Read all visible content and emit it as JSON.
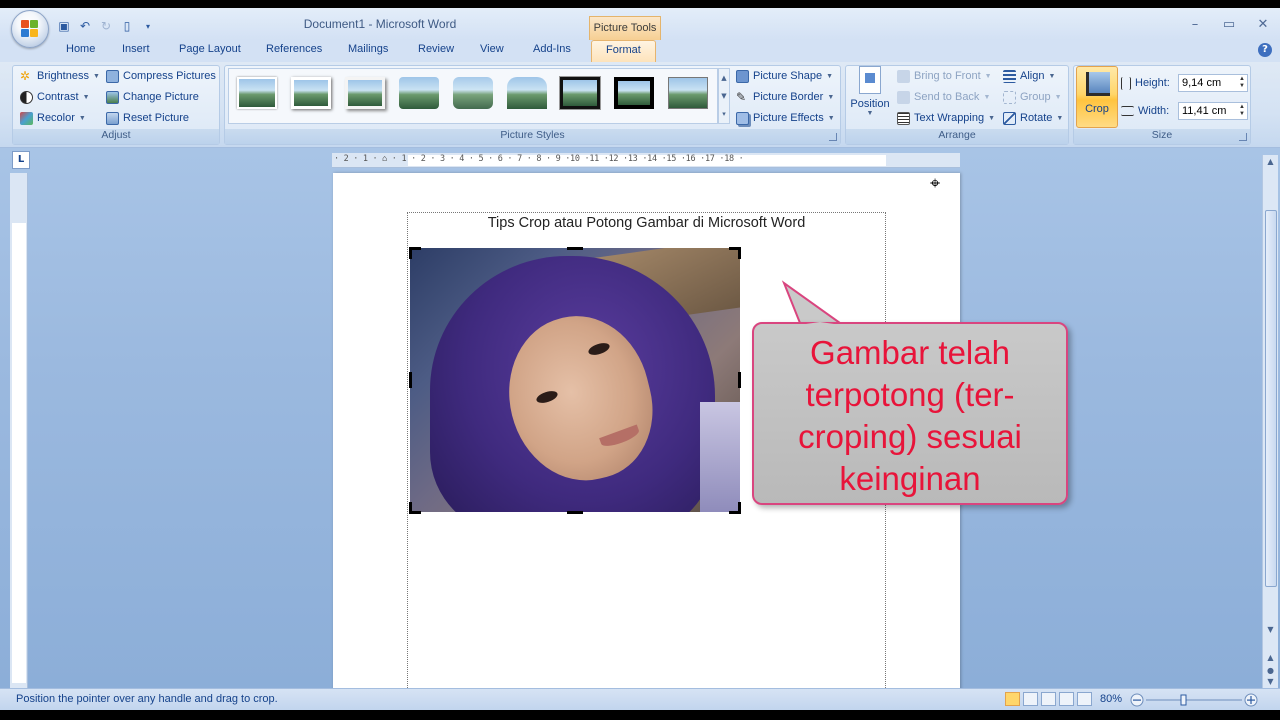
{
  "window": {
    "title": "Document1 - Microsoft Word",
    "context_tab": "Picture Tools",
    "controls": [
      "–",
      "▭",
      "✕"
    ]
  },
  "ribbon_tabs": [
    "Home",
    "Insert",
    "Page Layout",
    "References",
    "Mailings",
    "Review",
    "View",
    "Add-Ins",
    "Format"
  ],
  "adjust": {
    "label": "Adjust",
    "brightness": "Brightness",
    "contrast": "Contrast",
    "recolor": "Recolor",
    "compress": "Compress Pictures",
    "change": "Change Picture",
    "reset": "Reset Picture"
  },
  "picture_styles": {
    "label": "Picture Styles",
    "shape": "Picture Shape",
    "border": "Picture Border",
    "effects": "Picture Effects"
  },
  "arrange": {
    "label": "Arrange",
    "position": "Position",
    "bring_front": "Bring to Front",
    "send_back": "Send to Back",
    "text_wrapping": "Text Wrapping",
    "align": "Align",
    "group": "Group",
    "rotate": "Rotate"
  },
  "size": {
    "label": "Size",
    "crop": "Crop",
    "height_label": "Height:",
    "height_value": "9,14 cm",
    "width_label": "Width:",
    "width_value": "11,41 cm"
  },
  "ruler": {
    "horizontal": "· 2 · 1 · ⌂ · 1 · 2 · 3 · 4 · 5 · 6 · 7 · 8 · 9 ·10 ·11 ·12 ·13 ·14 ·15 ·16 ·17 ·18 ·",
    "corner": "L"
  },
  "document": {
    "caption": "Tips Crop atau Potong Gambar di Microsoft Word"
  },
  "callout": {
    "lines": [
      "Gambar telah",
      "terpotong (ter-",
      "croping) sesuai",
      "keinginan"
    ]
  },
  "status": {
    "message": "Position the pointer over any handle and drag to crop.",
    "zoom": "80%"
  },
  "colors": {
    "accent": "#f6cf93",
    "callout_text": "#e8143a",
    "callout_border": "#d9457f"
  }
}
